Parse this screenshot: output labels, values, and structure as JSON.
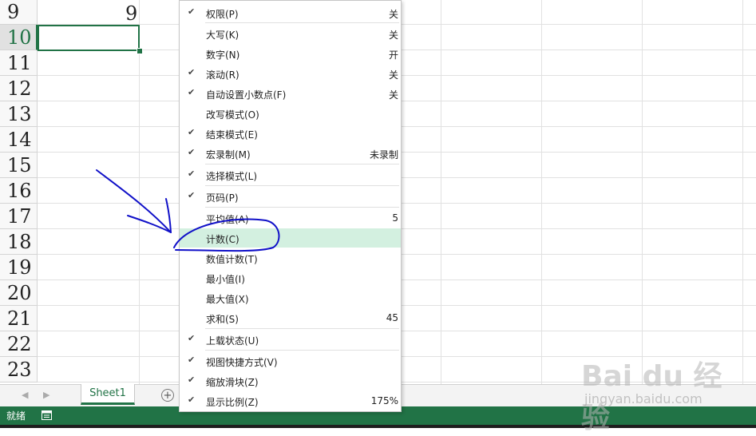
{
  "grid": {
    "row_numbers": [
      "9",
      "10",
      "11",
      "12",
      "13",
      "14",
      "15",
      "16",
      "17",
      "18",
      "19",
      "20",
      "21",
      "22",
      "23"
    ],
    "active_row": "10",
    "cell_B9_value": "9"
  },
  "sheet_tabs": {
    "sheet1_label": "Sheet1",
    "add_sheet_symbol": "+"
  },
  "status_bar": {
    "ready_label": "就绪"
  },
  "context_menu": {
    "items": [
      {
        "label": "权限(P)",
        "value": "关",
        "checked": true
      },
      {
        "label": "大写(K)",
        "value": "关",
        "checked": false
      },
      {
        "label": "数字(N)",
        "value": "开",
        "checked": false
      },
      {
        "label": "滚动(R)",
        "value": "关",
        "checked": true
      },
      {
        "label": "自动设置小数点(F)",
        "value": "关",
        "checked": true
      },
      {
        "label": "改写模式(O)",
        "value": "",
        "checked": false
      },
      {
        "label": "结束模式(E)",
        "value": "",
        "checked": true
      },
      {
        "label": "宏录制(M)",
        "value": "未录制",
        "checked": true
      },
      {
        "label": "选择模式(L)",
        "value": "",
        "checked": true
      },
      {
        "label": "页码(P)",
        "value": "",
        "checked": true
      },
      {
        "label": "平均值(A)",
        "value": "5",
        "checked": false
      },
      {
        "label": "计数(C)",
        "value": "",
        "checked": false,
        "highlighted": true
      },
      {
        "label": "数值计数(T)",
        "value": "",
        "checked": false
      },
      {
        "label": "最小值(I)",
        "value": "",
        "checked": false
      },
      {
        "label": "最大值(X)",
        "value": "",
        "checked": false
      },
      {
        "label": "求和(S)",
        "value": "45",
        "checked": false
      },
      {
        "label": "上载状态(U)",
        "value": "",
        "checked": true
      },
      {
        "label": "视图快捷方式(V)",
        "value": "",
        "checked": true
      },
      {
        "label": "缩放滑块(Z)",
        "value": "",
        "checked": true
      },
      {
        "label": "显示比例(Z)",
        "value": "175%",
        "checked": true
      }
    ]
  },
  "watermark": {
    "brand": "Bai du 经验",
    "url": "jingyan.baidu.com"
  },
  "colors": {
    "excel_green": "#217346",
    "highlight": "#d3f0e0",
    "annotation_ink": "#1010c8"
  }
}
